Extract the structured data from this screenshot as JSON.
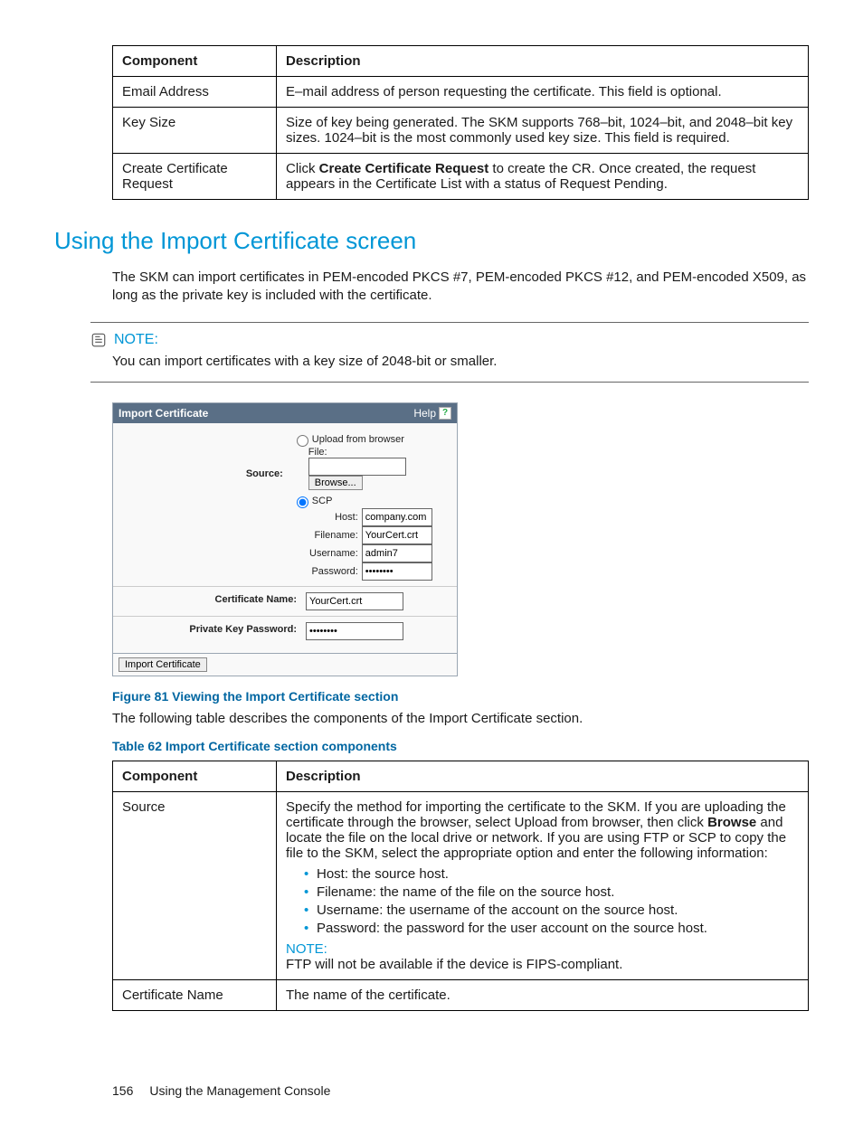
{
  "table1": {
    "headers": {
      "c1": "Component",
      "c2": "Description"
    },
    "rows": [
      {
        "c1": "Email Address",
        "c2": "E–mail address of person requesting the certificate. This field is optional."
      },
      {
        "c1": "Key Size",
        "c2": "Size of key being generated. The SKM supports 768–bit, 1024–bit, and 2048–bit key sizes. 1024–bit is the most commonly used key size. This field is required."
      },
      {
        "c1": "Create Certificate Request",
        "c2_pre": "Click ",
        "c2_strong": "Create Certificate Request",
        "c2_post": " to create the CR. Once created, the request appears in the Certificate List with a status of Request Pending."
      }
    ]
  },
  "heading2": "Using the Import Certificate screen",
  "intro_p": "The SKM can import certificates in PEM-encoded PKCS #7, PEM-encoded PKCS #12, and PEM-encoded X509, as long as the private key is included with the certificate.",
  "note": {
    "label": "NOTE:",
    "text": "You can import certificates with a key size of 2048-bit or smaller."
  },
  "shot": {
    "title": "Import Certificate",
    "help": "Help",
    "upload_label": "Upload from browser",
    "file_label": "File:",
    "browse_btn": "Browse...",
    "scp_label": "SCP",
    "source_label": "Source:",
    "host_label": "Host:",
    "host_val": "company.com",
    "filename_label": "Filename:",
    "filename_val": "YourCert.crt",
    "username_label": "Username:",
    "username_val": "admin7",
    "password_label": "Password:",
    "password_val": "********",
    "certname_label": "Certificate Name:",
    "certname_val": "YourCert.crt",
    "pk_label": "Private Key Password:",
    "pk_val": "********",
    "import_btn": "Import Certificate"
  },
  "caption_fig": "Figure 81 Viewing the Import Certificate section",
  "caption_p": "The following table describes the components of the Import Certificate section.",
  "caption_tab": "Table 62 Import Certificate section components",
  "table2": {
    "headers": {
      "c1": "Component",
      "c2": "Description"
    },
    "r1": {
      "c1": "Source",
      "para_pre": "Specify the method for importing the certificate to the SKM. If you are uploading the certificate through the browser, select Upload from browser, then click ",
      "para_strong": "Browse",
      "para_post": " and locate the file on the local drive or network. If you are using FTP or SCP to copy the file to the SKM, select the appropriate option and enter the following information:",
      "bullets": [
        "Host: the source host.",
        "Filename: the name of the file on the source host.",
        "Username: the username of the account on the source host.",
        "Password: the password for the user account on the source host."
      ],
      "note_label": "NOTE:",
      "note_text": "FTP will not be available if the device is FIPS-compliant."
    },
    "r2": {
      "c1": "Certificate Name",
      "c2": "The name of the certificate."
    }
  },
  "footer": {
    "pageno": "156",
    "title": "Using the Management Console"
  }
}
